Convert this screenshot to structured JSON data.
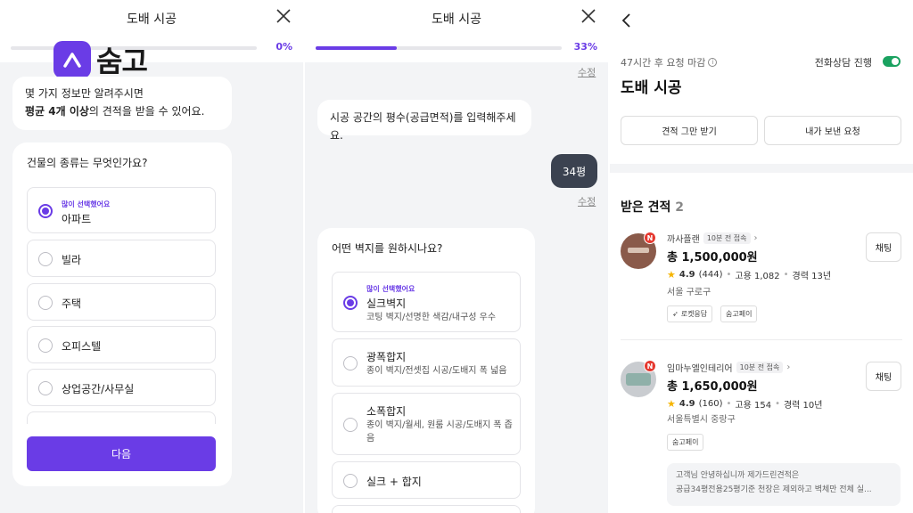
{
  "panel1": {
    "title": "도배 시공",
    "progress_pct": "0%",
    "progress_value": 0,
    "logo_text": "숨고",
    "intro_line1": "몇 가지 정보만 알려주시면",
    "intro_bold": "평균 4개 이상",
    "intro_line2_rest": "의 견적을 받을 수 있어요.",
    "question": "건물의 종류는 무엇인가요?",
    "popular_label": "많이 선택했어요",
    "options": [
      "아파트",
      "빌라",
      "주택",
      "오피스텔",
      "상업공간/사무실"
    ],
    "selected_index": 0,
    "next_label": "다음"
  },
  "panel2": {
    "title": "도배 시공",
    "progress_pct": "33%",
    "progress_value": 0.33,
    "edit_label": "수정",
    "area_question": "시공 공간의 평수(공급면적)를 입력해주세요.",
    "answer": "34평",
    "question": "어떤 벽지를 원하시나요?",
    "popular_label": "많이 선택했어요",
    "options": [
      {
        "label": "실크벽지",
        "desc": "코팅 벽지/선명한 색감/내구성 우수"
      },
      {
        "label": "광폭합지",
        "desc": "종이 벽지/전셋집 시공/도배지 폭 넓음"
      },
      {
        "label": "소폭합지",
        "desc": "종이 벽지/월세, 원룸 시공/도배지 폭 좁음"
      },
      {
        "label": "실크 + 합지",
        "desc": ""
      }
    ],
    "selected_index": 0
  },
  "panel3": {
    "deadline": "47시간 후 요청 마감",
    "phone_consult": "전화상담 진행",
    "request_title": "도배 시공",
    "stop_button": "견적 그만 받기",
    "my_request_button": "내가 보낸 요청",
    "quotes_title": "받은 견적",
    "quotes_count": "2",
    "quotes": [
      {
        "name": "까사플랜",
        "access": "10분 전 접속",
        "price": "총 1,500,000원",
        "rating": "4.9",
        "reviews": "(444)",
        "hires": "고용 1,082",
        "career": "경력 13년",
        "location": "서울 구로구",
        "tags": [
          "로켓응답",
          "숨고페이"
        ],
        "chat": "채팅"
      },
      {
        "name": "임마누엘인테리어",
        "access": "10분 전 접속",
        "price": "총 1,650,000원",
        "rating": "4.9",
        "reviews": "(160)",
        "hires": "고용 154",
        "career": "경력 10년",
        "location": "서울특별시 중랑구",
        "tags": [
          "숨고페이"
        ],
        "chat": "채팅",
        "message_line1": "고객님 안녕하십니까 제가드린견적은",
        "message_line2": "공급34평전용25평기준 천장은 제외하고 벽체만 전체 실..."
      }
    ]
  },
  "colors": {
    "accent": "#6a3ce6",
    "toggle_on": "#1aa260",
    "new_badge": "#e5382f",
    "user_bubble": "#3b4250"
  }
}
